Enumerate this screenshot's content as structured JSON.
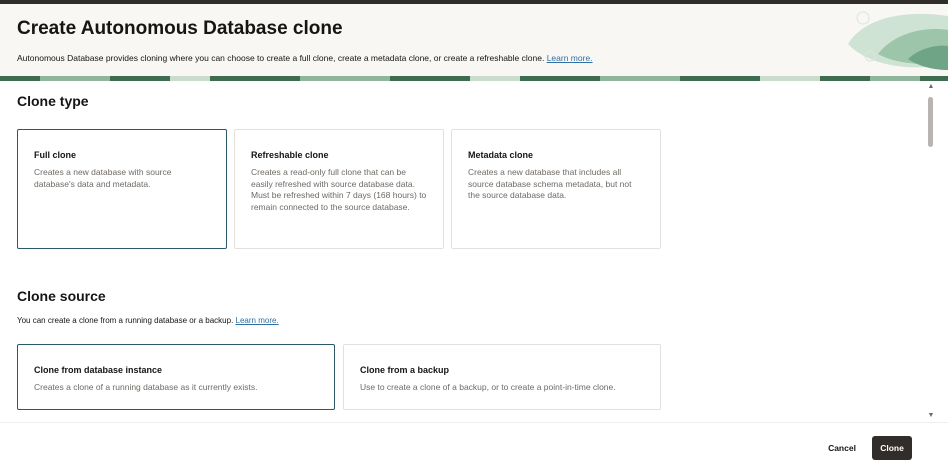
{
  "header": {
    "title": "Create Autonomous Database clone",
    "description": "Autonomous Database provides cloning where you can choose to create a full clone, create a metadata clone, or create a refreshable clone.",
    "learn_more": "Learn more."
  },
  "clone_type": {
    "title": "Clone type",
    "options": [
      {
        "title": "Full clone",
        "description": "Creates a new database with source database's data and metadata.",
        "selected": true
      },
      {
        "title": "Refreshable clone",
        "description": "Creates a read-only full clone that can be easily refreshed with source database data. Must be refreshed within 7 days (168 hours) to remain connected to the source database.",
        "selected": false
      },
      {
        "title": "Metadata clone",
        "description": "Creates a new database that includes all source database schema metadata, but not the source database data.",
        "selected": false
      }
    ]
  },
  "clone_source": {
    "title": "Clone source",
    "description": "You can create a clone from a running database or a backup.",
    "learn_more": "Learn more.",
    "options": [
      {
        "title": "Clone from database instance",
        "description": "Creates a clone of a running database as it currently exists.",
        "selected": true
      },
      {
        "title": "Clone from a backup",
        "description": "Use to create a clone of a backup, or to create a point-in-time clone.",
        "selected": false
      }
    ]
  },
  "footer": {
    "cancel_label": "Cancel",
    "clone_label": "Clone"
  },
  "colors": {
    "selected_border": "#2c5967",
    "primary_button": "#312d2a",
    "link": "#2f6fa3",
    "header_bg": "#f9f7f4"
  }
}
